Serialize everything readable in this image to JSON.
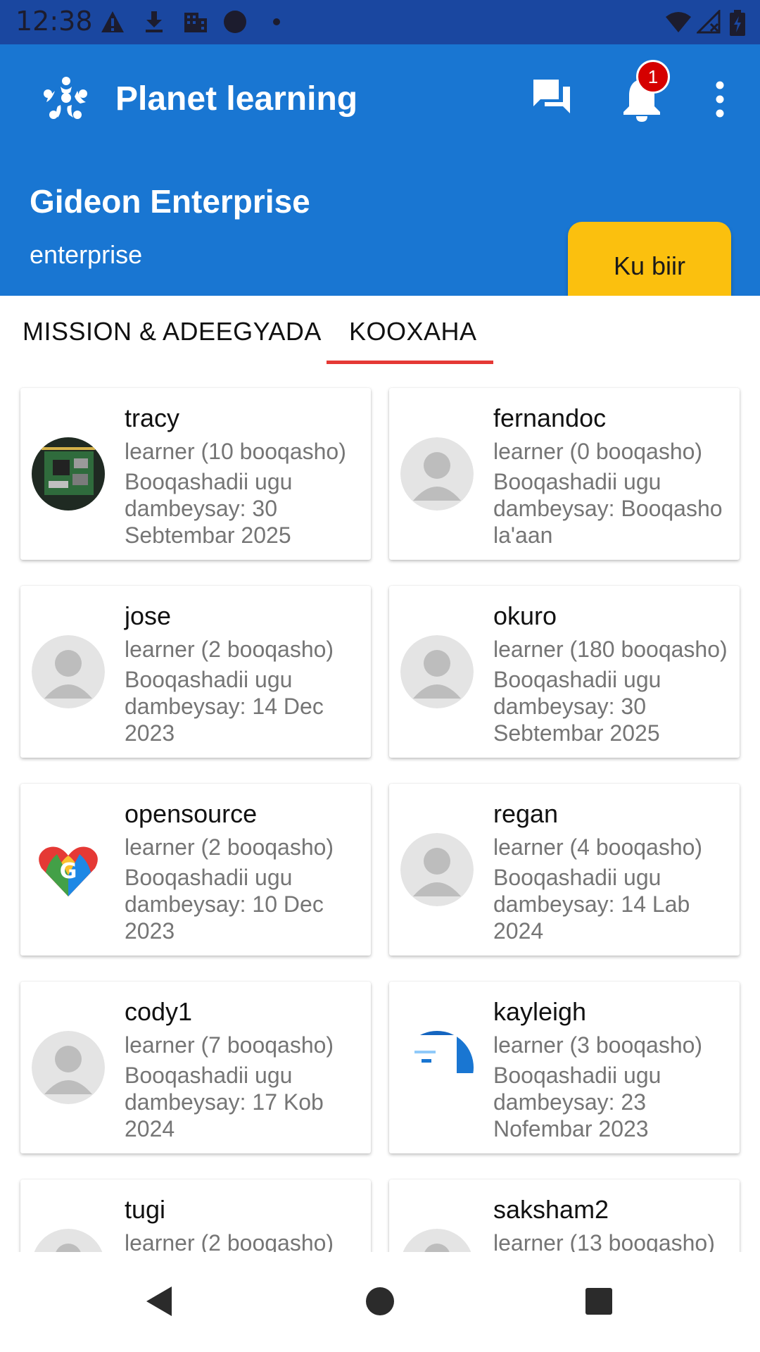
{
  "status_bar": {
    "time": "12:38"
  },
  "app_bar": {
    "title": "Planet learning",
    "notification_count": "1"
  },
  "team": {
    "name": "Gideon Enterprise",
    "type": "enterprise",
    "join_label": "Ku biir"
  },
  "tabs": [
    {
      "label": "MISSION & ADEEGYADA",
      "selected": false
    },
    {
      "label": "KOOXAHA",
      "selected": true
    }
  ],
  "members": [
    {
      "name": "tracy",
      "role": "learner (10 booqasho)",
      "last_visit": "Booqashadii ugu dambeysay: 30 Sebtembar 2025",
      "avatar": "circuit-board-photo"
    },
    {
      "name": "fernandoc",
      "role": "learner (0 booqasho)",
      "last_visit": "Booqashadii ugu dambeysay: Booqasho la'aan",
      "avatar": "default-person"
    },
    {
      "name": "jose",
      "role": "learner (2 booqasho)",
      "last_visit": "Booqashadii ugu dambeysay: 14 Dec 2023",
      "avatar": "default-person"
    },
    {
      "name": "okuro",
      "role": "learner (180 booqasho)",
      "last_visit": "Booqashadii ugu dambeysay: 30 Sebtembar 2025",
      "avatar": "default-person"
    },
    {
      "name": "opensource",
      "role": "learner (2 booqasho)",
      "last_visit": "Booqashadii ugu dambeysay: 10 Dec 2023",
      "avatar": "rainbow-heart-logo"
    },
    {
      "name": "regan",
      "role": "learner (4 booqasho)",
      "last_visit": "Booqashadii ugu dambeysay: 14 Lab 2024",
      "avatar": "default-person"
    },
    {
      "name": "cody1",
      "role": "learner (7 booqasho)",
      "last_visit": "Booqashadii ugu dambeysay: 17 Kob 2024",
      "avatar": "default-person"
    },
    {
      "name": "kayleigh",
      "role": "learner (3 booqasho)",
      "last_visit": "Booqashadii ugu dambeysay: 23 Nofembar 2023",
      "avatar": "screenshot-thumbnail"
    },
    {
      "name": "tugi",
      "role": "learner (2 booqasho)",
      "last_visit": "",
      "avatar": "default-person"
    },
    {
      "name": "saksham2",
      "role": "learner (13 booqasho)",
      "last_visit": "",
      "avatar": "default-person"
    }
  ],
  "colors": {
    "status_bar": "#1a47a0",
    "app_bar": "#1976d2",
    "join_button": "#fbc00e",
    "tab_indicator": "#e53935",
    "badge": "#d50000"
  }
}
